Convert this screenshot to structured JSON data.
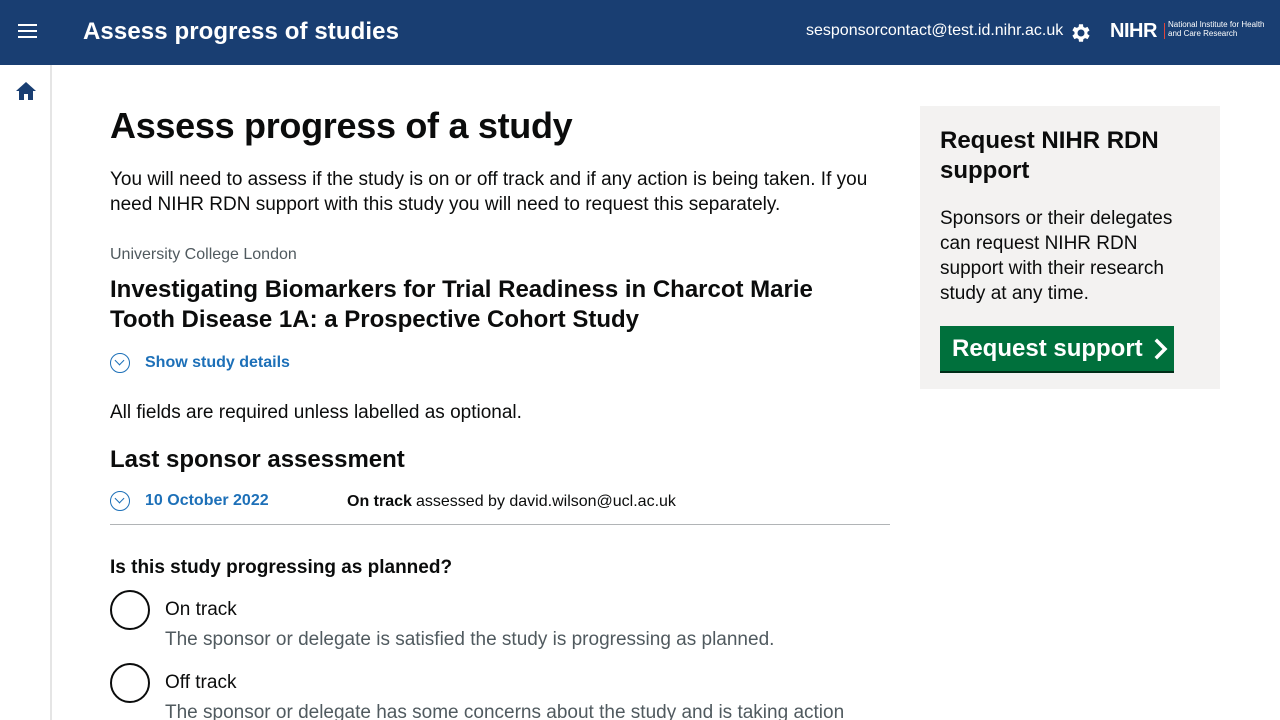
{
  "header": {
    "app_title": "Assess progress of studies",
    "user_email": "sesponsorcontact@test.id.nihr.ac.uk",
    "logo_short": "NIHR",
    "logo_full": "National Institute for Health and Care Research",
    "background": "#193e72"
  },
  "main": {
    "page_title": "Assess progress of a study",
    "intro": "You will need to assess if the study is on or off track and if any action is being taken. If you need NIHR RDN support with this study you will need to request this separately.",
    "organisation": "University College London",
    "study_title": "Investigating Biomarkers for Trial Readiness in Charcot Marie Tooth Disease 1A: a Prospective Cohort Study",
    "details_toggle": "Show study details",
    "required_note": "All fields are required unless labelled as optional.",
    "last_assessment": {
      "heading": "Last sponsor assessment",
      "date": "10 October 2022",
      "status": "On track",
      "assessed_by": "assessed by david.wilson@ucl.ac.uk"
    },
    "question": "Is this study progressing as planned?",
    "options": [
      {
        "label": "On track",
        "hint": "The sponsor or delegate is satisfied the study is progressing as planned."
      },
      {
        "label": "Off track",
        "hint": "The sponsor or delegate has some concerns about the study and is taking action"
      }
    ]
  },
  "sidebar": {
    "title": "Request NIHR RDN support",
    "text": "Sponsors or their delegates can request NIHR RDN support with their research study at any time.",
    "button_label": "Request support",
    "button_color": "#00703c"
  },
  "icons": [
    "menu-icon",
    "gear-icon",
    "home-icon",
    "chevron-down-icon",
    "chevron-right-icon"
  ],
  "colors": {
    "link": "#1d70b8",
    "panel": "#f3f2f1"
  }
}
